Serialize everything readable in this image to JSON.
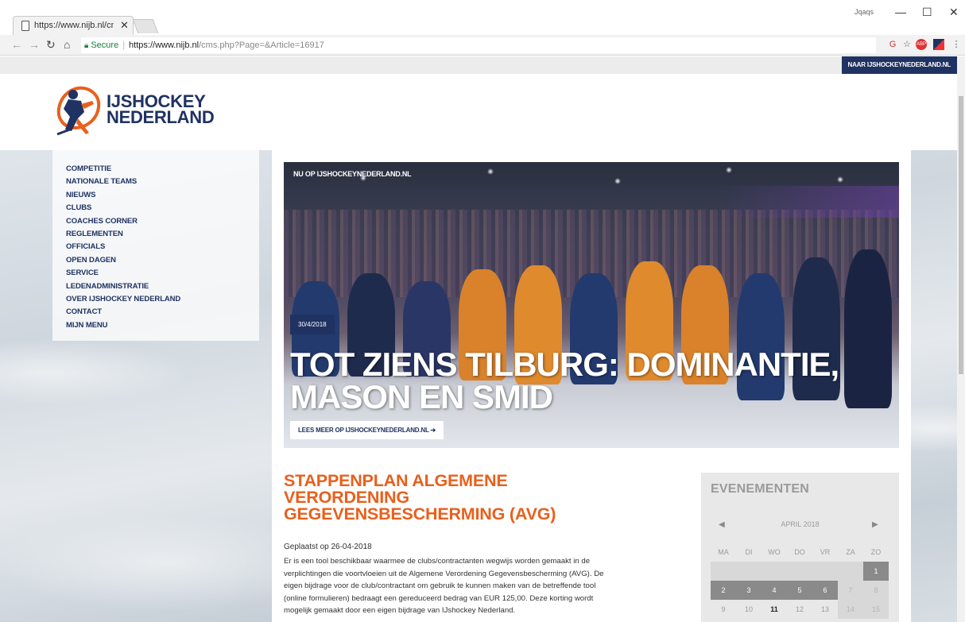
{
  "browser": {
    "tab_title": "https://www.nijb.nl/cms.",
    "tab_close": "✕",
    "user_label": "Jqaqs",
    "win_min": "—",
    "win_max": "☐",
    "win_close": "✕",
    "address": {
      "secure_label": "Secure",
      "host": "https://www.nijb.nl",
      "path": "/cms.php?Page=&Article=16917"
    }
  },
  "top_cta": "NAAR IJSHOCKEYNEDERLAND.NL",
  "logo": {
    "line1": "IJSHOCKEY",
    "line2": "NEDERLAND"
  },
  "sidenav": {
    "items": [
      {
        "label": "COMPETITIE"
      },
      {
        "label": "NATIONALE TEAMS"
      },
      {
        "label": "NIEUWS"
      },
      {
        "label": "CLUBS"
      },
      {
        "label": "COACHES CORNER"
      },
      {
        "label": "REGLEMENTEN"
      },
      {
        "label": "OFFICIALS"
      },
      {
        "label": "OPEN DAGEN"
      },
      {
        "label": "SERVICE"
      },
      {
        "label": "LEDENADMINISTRATIE"
      },
      {
        "label": "OVER IJSHOCKEY NEDERLAND"
      },
      {
        "label": "CONTACT"
      },
      {
        "label": "MIJN MENU"
      }
    ]
  },
  "hero": {
    "tag": "NU OP IJSHOCKEYNEDERLAND.NL",
    "date": "30/4/2018",
    "headline": "TOT ZIENS TILBURG: DOMINANTIE, MASON EN SMID",
    "more_label": "LEES MEER OP IJSHOCKEYNEDERLAND.NL"
  },
  "article": {
    "title": "STAPPENPLAN ALGEMENE VERORDENING GEGEVENSBESCHERMING (AVG)",
    "posted": "Geplaatst op 26-04-2018",
    "body": "Er is een tool beschikbaar waarmee de clubs/contractanten wegwijs worden gemaakt in de verplichtingen die voortvloeien uit de Algemene Verordening Gegevensbescherming (AVG). De eigen bijdrage voor de club/contractant om gebruik te kunnen maken van de betreffende tool (online formulieren) bedraagt een gereduceerd bedrag van EUR 125,00. Deze korting wordt mogelijk gemaakt door een eigen bijdrage van IJshockey Nederland."
  },
  "events": {
    "heading": "EVENEMENTEN",
    "month": "APRIL 2018",
    "weekdays": [
      "MA",
      "DI",
      "WO",
      "DO",
      "VR",
      "ZA",
      "ZO"
    ],
    "week1": [
      "",
      "",
      "",
      "",
      "",
      "",
      "1"
    ],
    "week2": [
      "2",
      "3",
      "4",
      "5",
      "6",
      "7",
      "8"
    ],
    "week3": [
      "9",
      "10",
      "11",
      "12",
      "13",
      "14",
      "15"
    ]
  }
}
